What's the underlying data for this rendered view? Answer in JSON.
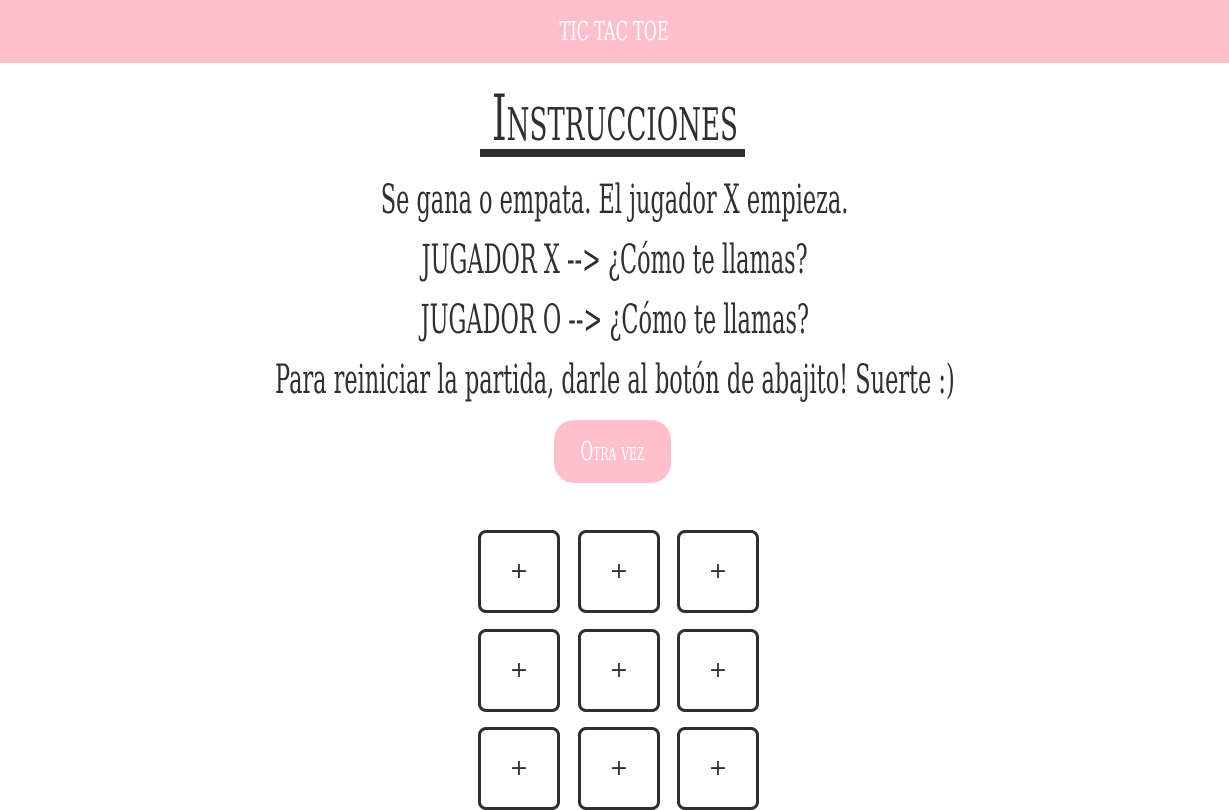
{
  "header": {
    "title": "TIC TAC TOE"
  },
  "instructions": {
    "heading": "Instrucciones",
    "lines": [
      "Se gana o empata. El jugador X empieza.",
      "JUGADOR X --> ¿Cómo te llamas?",
      "JUGADOR O --> ¿Cómo te llamas?",
      "Para reiniciar la partida, darle al botón de abajito! Suerte :)"
    ]
  },
  "reset_button": {
    "label": "Otra vez"
  },
  "board": {
    "cells": [
      "+",
      "+",
      "+",
      "+",
      "+",
      "+",
      "+",
      "+",
      "+"
    ]
  },
  "colors": {
    "accent_pink": "#ffbfcb",
    "text_dark": "#2f2f2f",
    "background": "#ffffff"
  }
}
